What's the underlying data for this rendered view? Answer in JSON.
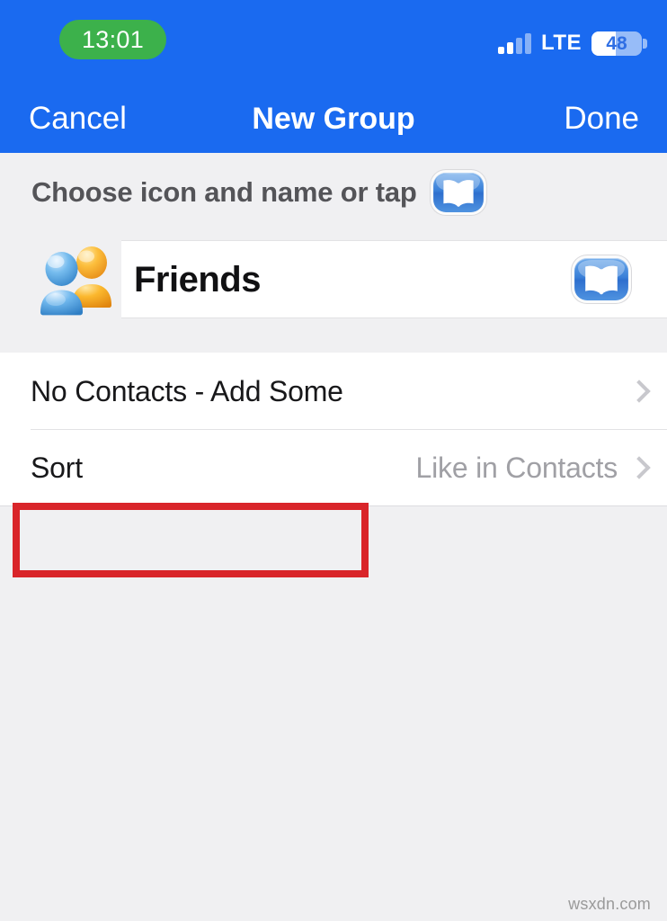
{
  "status_bar": {
    "time": "13:01",
    "network_label": "LTE",
    "battery_percent": "48",
    "signal_icon": "signal-bars-icon",
    "battery_icon": "battery-icon",
    "time_pill_color": "#3cb14b",
    "bar_color": "#1a6af0"
  },
  "navbar": {
    "cancel_label": "Cancel",
    "title": "New Group",
    "done_label": "Done"
  },
  "header": {
    "choose_text": "Choose icon and name or tap",
    "book_icon": "book-icon"
  },
  "name_section": {
    "avatar_icon": "group-contacts-avatar-icon",
    "group_name": "Friends",
    "field_book_icon": "book-icon"
  },
  "list": {
    "rows": [
      {
        "label": "No Contacts - Add Some",
        "value": "",
        "chevron_icon": "chevron-right-icon",
        "highlighted": true
      },
      {
        "label": "Sort",
        "value": "Like in Contacts",
        "chevron_icon": "chevron-right-icon",
        "highlighted": false
      }
    ]
  },
  "annotation": {
    "color": "#d9252a"
  },
  "watermark": {
    "text": "wsxdn.com"
  }
}
